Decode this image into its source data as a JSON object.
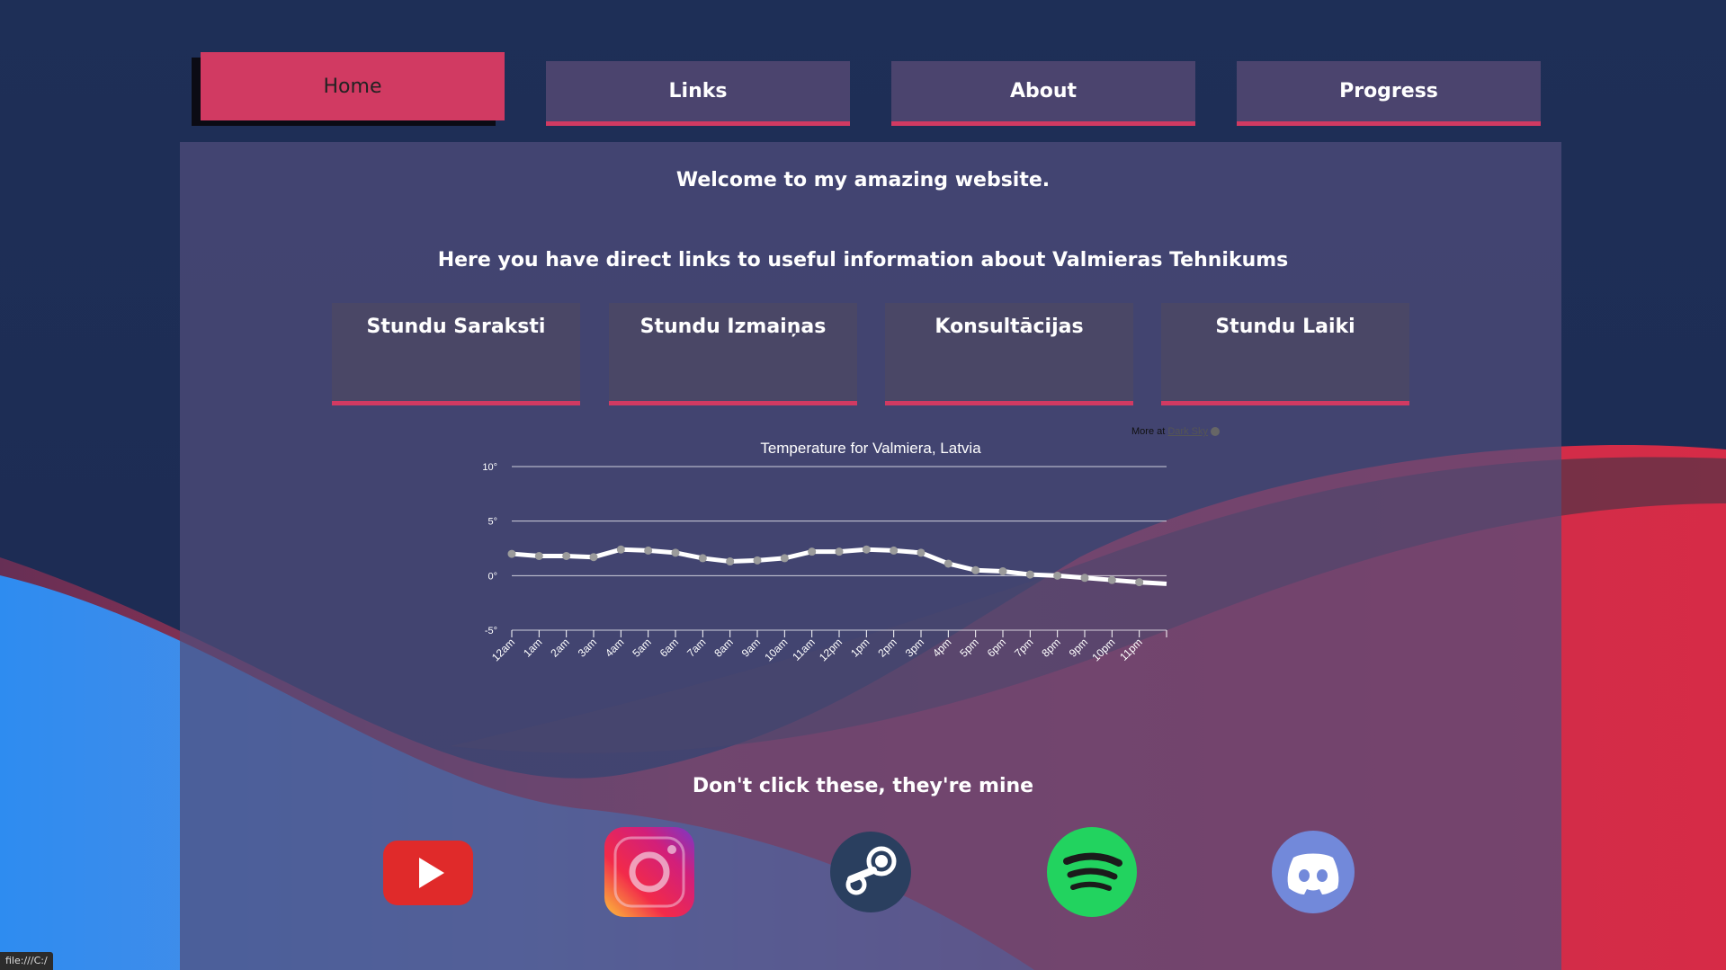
{
  "nav": {
    "items": [
      {
        "label": "Home",
        "active": true
      },
      {
        "label": "Links",
        "active": false
      },
      {
        "label": "About",
        "active": false
      },
      {
        "label": "Progress",
        "active": false
      }
    ]
  },
  "main": {
    "welcome": "Welcome to my amazing website.",
    "links_heading": "Here you have direct links to useful information about Valmieras Tehnikums",
    "link_cards": [
      {
        "label": "Stundu Saraksti"
      },
      {
        "label": "Stundu Izmaiņas"
      },
      {
        "label": "Konsultācijas"
      },
      {
        "label": "Stundu Laiki"
      }
    ],
    "social_heading": "Don't click these, they're mine",
    "social_icons": [
      "youtube-icon",
      "instagram-icon",
      "steam-icon",
      "spotify-icon",
      "discord-icon"
    ]
  },
  "widget": {
    "more_at": "More at",
    "more_link": "Dark Sky"
  },
  "chart_data": {
    "type": "line",
    "title": "Temperature for Valmiera, Latvia",
    "categories": [
      "12am",
      "1am",
      "2am",
      "3am",
      "4am",
      "5am",
      "6am",
      "7am",
      "8am",
      "9am",
      "10am",
      "11am",
      "12pm",
      "1pm",
      "2pm",
      "3pm",
      "4pm",
      "5pm",
      "6pm",
      "7pm",
      "8pm",
      "9pm",
      "10pm",
      "11pm"
    ],
    "series": [
      {
        "values": [
          2.0,
          1.8,
          1.8,
          1.7,
          2.4,
          2.3,
          2.1,
          1.6,
          1.3,
          1.4,
          1.6,
          2.2,
          2.2,
          2.4,
          2.3,
          2.1,
          1.1,
          0.5,
          0.4,
          0.1,
          0.0,
          -0.2,
          -0.4,
          -0.6
        ]
      }
    ],
    "yticks": [
      "10°",
      "5°",
      "0°",
      "-5°"
    ],
    "ylim": [
      -5,
      10
    ],
    "grid": true,
    "colors": {
      "line": "#ffffff",
      "marker": "#9b9b9b"
    }
  },
  "status_bar": {
    "text": "file:///C:/"
  },
  "colors": {
    "accent": "#d13a62",
    "nav": "#4b446e",
    "card": "#4a4766"
  }
}
